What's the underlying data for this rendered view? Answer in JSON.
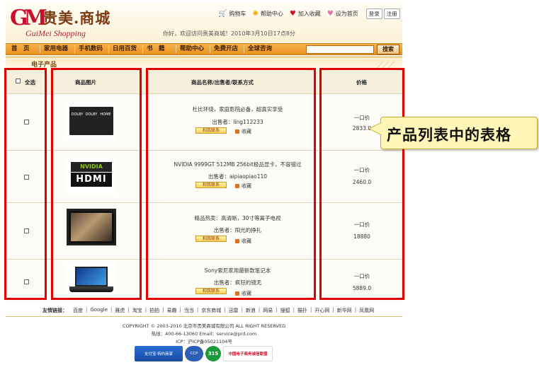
{
  "header": {
    "logo_mark": "GM",
    "logo_title": "贵美.商城",
    "logo_subtitle": "GuiMei Shopping",
    "top_links": [
      {
        "label": "购物车",
        "icon": "cart-icon"
      },
      {
        "label": "帮助中心",
        "icon": "help-icon"
      },
      {
        "label": "加入收藏",
        "icon": "heart-icon"
      },
      {
        "label": "设为首页",
        "icon": "home-icon"
      }
    ],
    "login_label": "登录",
    "register_label": "注册",
    "welcome": "你好，欢迎访问贵美商城！2010年3月10日17点8分"
  },
  "nav": {
    "items": [
      "首　页",
      "家用电器",
      "手机数码",
      "日用百货",
      "书　籍",
      "帮助中心",
      "免费开店",
      "全球咨询"
    ],
    "search_placeholder": "",
    "search_label": "搜索"
  },
  "section": {
    "title": "电子产品"
  },
  "table": {
    "headers": {
      "select_all": "全选",
      "image": "商品图片",
      "name": "商品名称/出售者/联系方式",
      "price": "价格"
    },
    "contact_label": "和我联系",
    "favorite_label": "收藏",
    "price_type": "一口价",
    "rows": [
      {
        "name": "杜比环绕，家庭影院必备，超真实享受",
        "seller_label": "出售者：",
        "seller": "ling112233",
        "price": "2833.0",
        "image": "dolby-image"
      },
      {
        "name": "NVIDIA 9999GT 512MB 256bit极品显卡，不容错过",
        "seller_label": "出售者：",
        "seller": "aipiaopiao110",
        "price": "2460.0",
        "image": "nvidia-hdmi-image"
      },
      {
        "name": "精品热卖：高清晰，30寸等离子电视",
        "seller_label": "出售者：",
        "seller": "阳光的挣扎",
        "price": "18880",
        "image": "tv-image"
      },
      {
        "name": "Sony索尼家用最新款笔记本",
        "seller_label": "出售者：",
        "seller": "疯狂的镜无",
        "price": "5889.0",
        "image": "laptop-image"
      }
    ]
  },
  "callout": {
    "text": "产品列表中的表格"
  },
  "footer": {
    "links_title": "友情链接：",
    "links": [
      "百度",
      "Google",
      "雅虎",
      "淘宝",
      "拍拍",
      "易趣",
      "当当",
      "京东商城",
      "迅雷",
      "新浪",
      "网易",
      "搜狐",
      "猫扑",
      "开心网",
      "新华网",
      "凤凰网"
    ],
    "copyright": "COPYRIGHT © 2003-2010 北京市贵美商城有限公司 ALL RIGHT RESERVED",
    "hotline": "热线：400-66-13060 Email：service@prd.com",
    "icp": "ICP：沪ICP备05021104号",
    "badges": [
      "支付宝·特约商家",
      "CCP",
      "315",
      "中国电子商务诚信联盟"
    ]
  },
  "colors": {
    "nav_orange": "#e9901e",
    "highlight_red": "#e00000",
    "callout_yellow": "#fff6b8"
  }
}
